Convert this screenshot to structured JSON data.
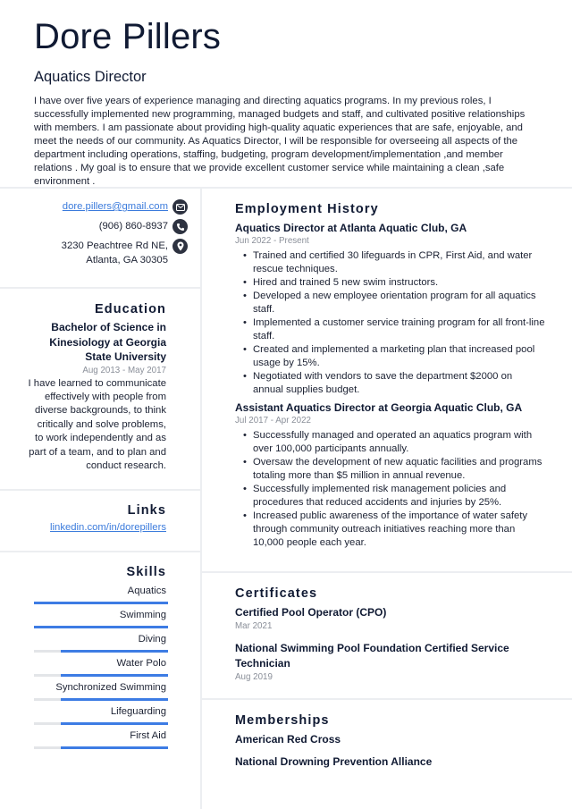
{
  "header": {
    "name": "Dore Pillers",
    "title": "Aquatics Director",
    "summary": "I have over five years of experience managing and directing aquatics programs. In my previous roles, I successfully implemented new programming, managed budgets and staff, and cultivated positive relationships with members. I am passionate about providing high-quality aquatic experiences that are safe, enjoyable, and meet the needs of our community. As Aquatics Director, I will be responsible for overseeing all aspects of the department including operations, staffing, budgeting, program development/implementation ,and member relations . My goal is to ensure that we provide excellent customer service while maintaining a clean ,safe environment ."
  },
  "contact": {
    "email": "dore.pillers@gmail.com",
    "email_icon": "envelope-icon",
    "phone": "(906) 860-8937",
    "phone_icon": "phone-icon",
    "address": "3230 Peachtree Rd NE, Atlanta, GA 30305",
    "address_icon": "map-pin-icon"
  },
  "education": {
    "title": "Education",
    "degree": "Bachelor of Science in Kinesiology at Georgia State University",
    "dates": "Aug 2013 - May 2017",
    "description": "I have learned to communicate effectively with people from diverse backgrounds, to think critically and solve problems, to work independently and as part of a team, and to plan and conduct research."
  },
  "links": {
    "title": "Links",
    "items": [
      "linkedin.com/in/dorepillers"
    ]
  },
  "skills": {
    "title": "Skills",
    "accent": "#3d7ce4",
    "items": [
      {
        "name": "Aquatics",
        "level": 1.0
      },
      {
        "name": "Swimming",
        "level": 1.0
      },
      {
        "name": "Diving",
        "level": 0.8
      },
      {
        "name": "Water Polo",
        "level": 0.8
      },
      {
        "name": "Synchronized Swimming",
        "level": 0.8
      },
      {
        "name": "Lifeguarding",
        "level": 0.8
      },
      {
        "name": "First Aid",
        "level": 0.8
      }
    ]
  },
  "employment": {
    "title": "Employment History",
    "jobs": [
      {
        "heading": "Aquatics Director at Atlanta Aquatic Club, GA",
        "dates": "Jun 2022 - Present",
        "bullets": [
          "Trained and certified 30 lifeguards in CPR, First Aid, and water rescue techniques.",
          "Hired and trained 5 new swim instructors.",
          "Developed a new employee orientation program for all aquatics staff.",
          "Implemented a customer service training program for all front-line staff.",
          "Created and implemented a marketing plan that increased pool usage by 15%.",
          "Negotiated with vendors to save the department $2000 on annual supplies budget."
        ]
      },
      {
        "heading": "Assistant Aquatics Director at Georgia Aquatic Club, GA",
        "dates": "Jul 2017 - Apr 2022",
        "bullets": [
          "Successfully managed and operated an aquatics program with over 100,000 participants annually.",
          "Oversaw the development of new aquatic facilities and programs totaling more than $5 million in annual revenue.",
          "Successfully implemented risk management policies and procedures that reduced accidents and injuries by 25%.",
          "Increased public awareness of the importance of water safety through community outreach initiatives reaching more than 10,000 people each year."
        ]
      }
    ]
  },
  "certificates": {
    "title": "Certificates",
    "items": [
      {
        "name": "Certified Pool Operator (CPO)",
        "date": "Mar 2021"
      },
      {
        "name": "National Swimming Pool Foundation Certified Service Technician",
        "date": "Aug 2019"
      }
    ]
  },
  "memberships": {
    "title": "Memberships",
    "items": [
      "American Red Cross",
      "National Drowning Prevention Alliance"
    ]
  }
}
